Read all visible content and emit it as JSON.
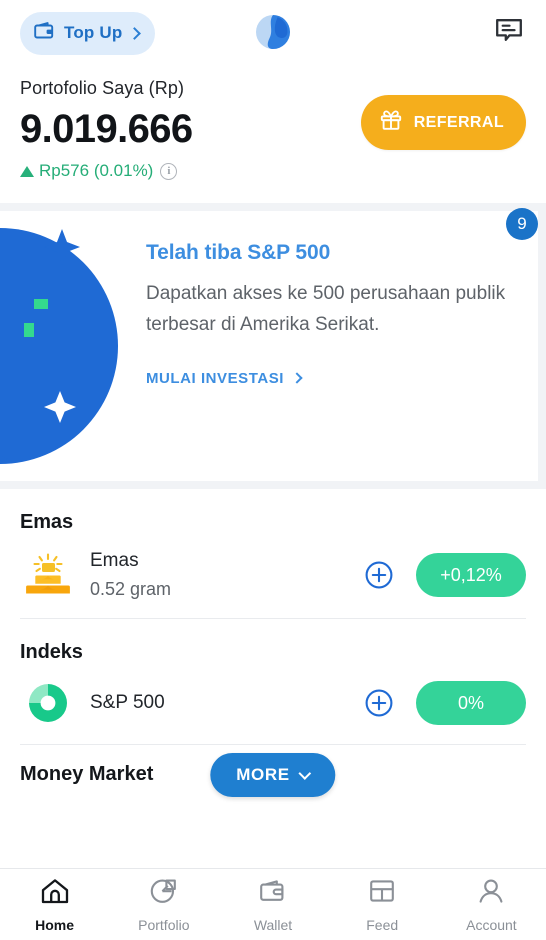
{
  "topbar": {
    "topup_label": "Top Up",
    "topup_icon": "wallet-icon",
    "chevron_icon": "chevron-right-icon",
    "logo_icon": "app-logo",
    "chat_icon": "chat-bubble-icon"
  },
  "portfolio": {
    "label": "Portofolio Saya (Rp)",
    "amount": "9.019.666",
    "gain": "Rp576 (0.01%)",
    "gain_direction": "up",
    "gain_color": "#25ad77",
    "info_icon": "info-icon",
    "info_glyph": "i",
    "referral_label": "REFERRAL",
    "referral_icon": "gift-icon",
    "referral_color": "#f5ae1c"
  },
  "banner": {
    "badge": "9",
    "badge_color": "#1a73c8",
    "title": "Telah tiba S&P 500",
    "description": "Dapatkan akses ke 500 perusahaan publik terbesar di Amerika Serikat.",
    "cta_label": "MULAI INVESTASI",
    "cta_icon": "chevron-right-icon",
    "art_icon": "globe-illustration",
    "accent_color": "#3d8ee0"
  },
  "sections": [
    {
      "heading": "Emas",
      "rows": [
        {
          "icon": "gold-bars-icon",
          "name": "Emas",
          "sub": "0.52 gram",
          "add_icon": "plus-circle-icon",
          "pct": "+0,12%",
          "pct_color": "#34d399"
        }
      ]
    },
    {
      "heading": "Indeks",
      "rows": [
        {
          "icon": "pie-chart-icon",
          "name": "S&P 500",
          "sub": "",
          "add_icon": "plus-circle-icon",
          "pct": "0%",
          "pct_color": "#34d399"
        }
      ]
    }
  ],
  "money_market": {
    "heading": "Money Market",
    "more_label": "MORE",
    "more_icon": "chevron-down-icon",
    "more_color": "#1f7fd0"
  },
  "bottom_nav": {
    "items": [
      {
        "label": "Home",
        "icon": "home-icon",
        "active": true
      },
      {
        "label": "Portfolio",
        "icon": "pie-chart-icon",
        "active": false
      },
      {
        "label": "Wallet",
        "icon": "wallet-icon",
        "active": false
      },
      {
        "label": "Feed",
        "icon": "grid-layout-icon",
        "active": false
      },
      {
        "label": "Account",
        "icon": "person-icon",
        "active": false
      }
    ]
  }
}
